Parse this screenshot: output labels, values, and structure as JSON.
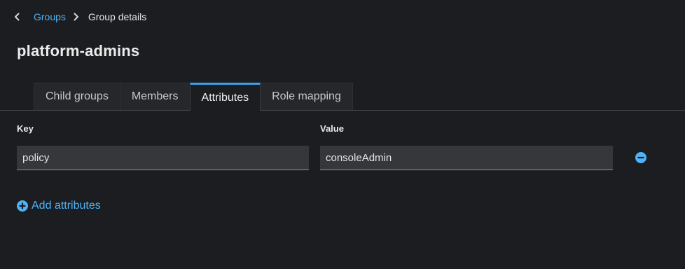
{
  "breadcrumb": {
    "parent_label": "Groups",
    "current_label": "Group details"
  },
  "page": {
    "title": "platform-admins"
  },
  "tabs": [
    {
      "label": "Child groups",
      "active": false
    },
    {
      "label": "Members",
      "active": false
    },
    {
      "label": "Attributes",
      "active": true
    },
    {
      "label": "Role mapping",
      "active": false
    }
  ],
  "attributes": {
    "key_header": "Key",
    "value_header": "Value",
    "rows": [
      {
        "key": "policy",
        "value": "consoleAdmin"
      }
    ],
    "add_label": "Add attributes"
  },
  "colors": {
    "accent": "#4fb3f6",
    "background": "#1b1d21",
    "tab_active_border": "#3d9fe8"
  },
  "icons": {
    "back": "chevron-left-icon",
    "separator": "chevron-right-icon",
    "remove": "minus-circle-icon",
    "add": "plus-circle-icon"
  }
}
